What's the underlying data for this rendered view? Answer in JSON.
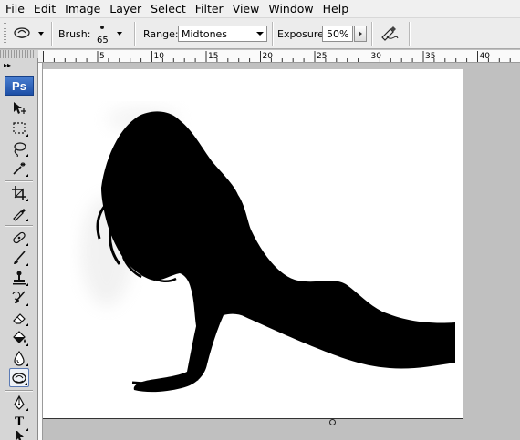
{
  "menu": [
    "File",
    "Edit",
    "Image",
    "Layer",
    "Select",
    "Filter",
    "View",
    "Window",
    "Help"
  ],
  "options": {
    "tool_icon": "burn-tool-icon",
    "brush_label": "Brush:",
    "brush_size": "65",
    "range_label": "Range:",
    "range_value": "Midtones",
    "exposure_label": "Exposure:",
    "exposure_value": "50%",
    "airbrush_icon": "airbrush-icon"
  },
  "ruler": {
    "labels": [
      "5",
      "10",
      "15",
      "20",
      "25",
      "30",
      "35",
      "40"
    ]
  },
  "toolbox": {
    "logo": "Ps",
    "text_tool": "T",
    "tools": [
      "move-tool-icon",
      "marquee-tool-icon",
      "lasso-tool-icon",
      "magic-wand-icon",
      "crop-tool-icon",
      "eyedropper-icon",
      "healing-brush-icon",
      "brush-tool-icon",
      "clone-stamp-icon",
      "history-brush-icon",
      "eraser-icon",
      "paint-bucket-icon",
      "blur-tool-icon",
      "burn-tool-icon",
      "pen-tool-icon",
      "type-tool-icon",
      "path-selection-icon"
    ],
    "active_tool": "burn-tool-icon"
  },
  "canvas": {
    "background": "#ffffff",
    "subject": "black silhouette"
  }
}
